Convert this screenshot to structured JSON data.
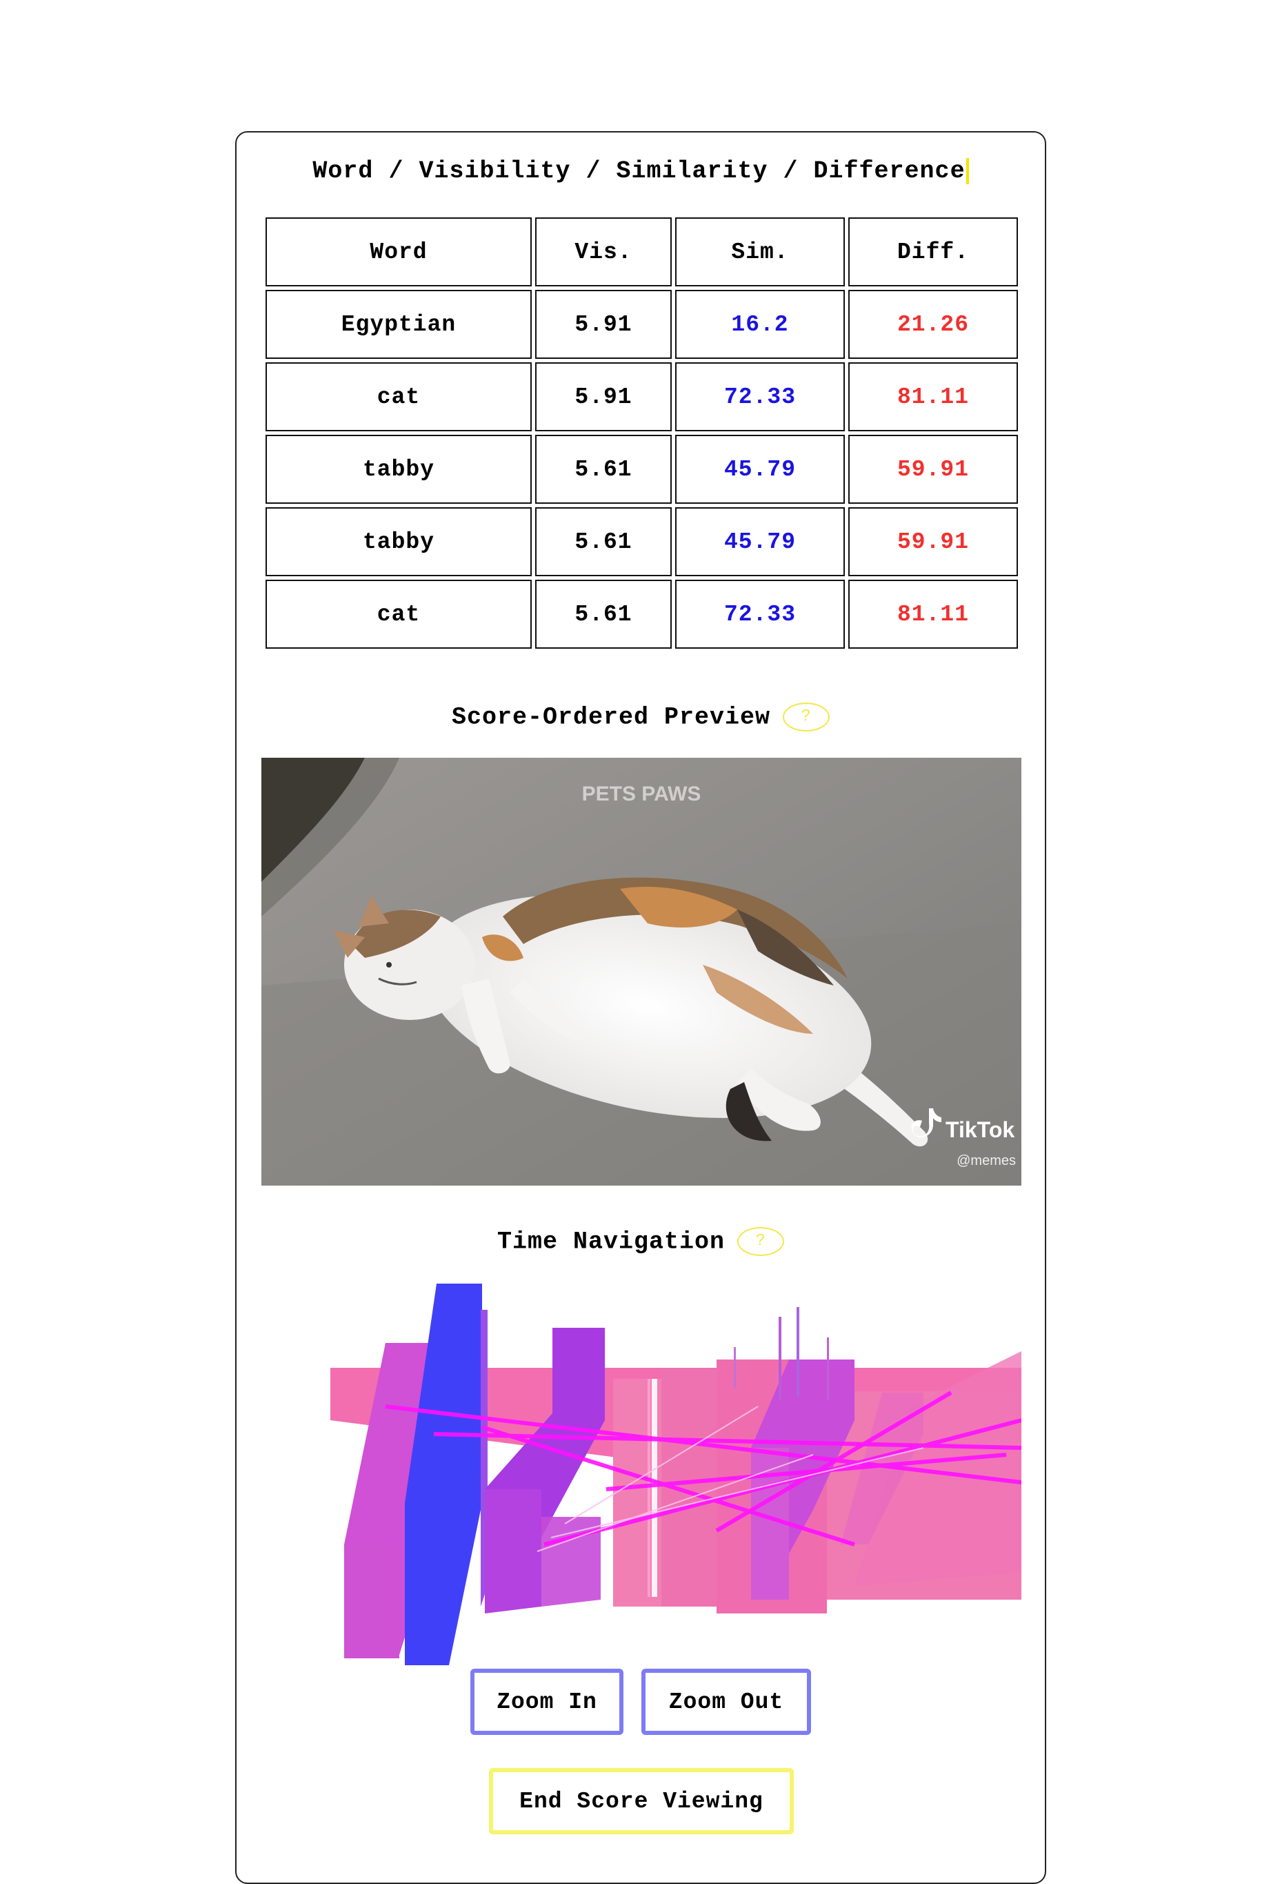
{
  "header": {
    "title": "Word / Visibility / Similarity / Difference"
  },
  "table": {
    "columns": [
      "Word",
      "Vis.",
      "Sim.",
      "Diff."
    ],
    "rows": [
      {
        "word": "Egyptian",
        "vis": "5.91",
        "sim": "16.2",
        "diff": "21.26"
      },
      {
        "word": "cat",
        "vis": "5.91",
        "sim": "72.33",
        "diff": "81.11"
      },
      {
        "word": "tabby",
        "vis": "5.61",
        "sim": "45.79",
        "diff": "59.91"
      },
      {
        "word": "tabby",
        "vis": "5.61",
        "sim": "45.79",
        "diff": "59.91"
      },
      {
        "word": "cat",
        "vis": "5.61",
        "sim": "72.33",
        "diff": "81.11"
      }
    ]
  },
  "preview": {
    "title": "Score-Ordered Preview",
    "help": "?",
    "watermark_top": "PETS PAWS",
    "watermark_brand": "TikTok",
    "watermark_handle": "@memes"
  },
  "navigation": {
    "title": "Time Navigation",
    "help": "?"
  },
  "buttons": {
    "zoom_in": "Zoom In",
    "zoom_out": "Zoom Out",
    "end": "End Score Viewing"
  },
  "colors": {
    "sim": "#1a14e0",
    "diff": "#f0312f",
    "accent_yellow": "#f7f46f",
    "accent_blue": "#7d7cf5"
  }
}
